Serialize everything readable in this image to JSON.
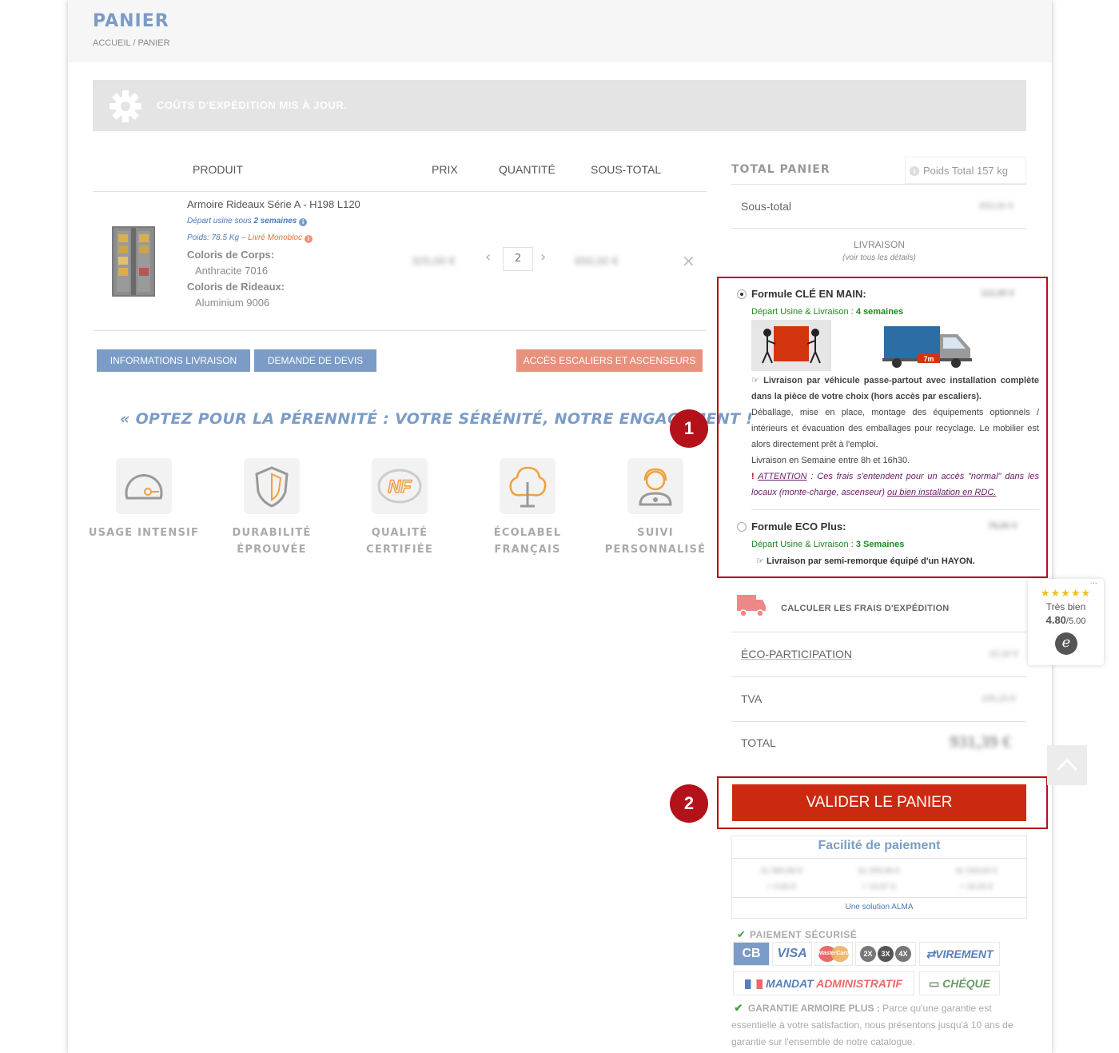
{
  "header": {
    "title": "PANIER",
    "breadcrumb": "ACCUEIL / PANIER"
  },
  "notice": {
    "text": "COÛTS D'EXPÉDITION MIS À JOUR.",
    "icon": "gear-icon"
  },
  "cart_table": {
    "columns": [
      "PRODUIT",
      "PRIX",
      "QUANTITÉ",
      "SOUS-TOTAL"
    ],
    "item": {
      "name": "Armoire Rideaux Série A - H198 L120",
      "departure_prefix": "Départ usine sous ",
      "departure_weeks": "2 semaines",
      "weight_line": "Poids: 78.5 Kg",
      "delivery_line": "Livré Monobloc",
      "attr1_label": "Coloris de Corps:",
      "attr1_value": "Anthracite 7016",
      "attr2_label": "Coloris de Rideaux:",
      "attr2_value": "Aluminium 9006",
      "price": "325,00 €",
      "quantity": "2",
      "subtotal": "650,00 €"
    }
  },
  "buttons": {
    "delivery_info": "INFORMATIONS LIVRAISON",
    "quote_request": "DEMANDE DE DEVIS",
    "stairs_access": "ACCÈS ESCALIERS ET ASCENSEURS"
  },
  "slogan": "« OPTEZ POUR LA PÉRENNITÉ : VOTRE SÉRÉNITÉ, NOTRE ENGAGEMENT !",
  "annotations": {
    "one": "1",
    "two": "2"
  },
  "features": [
    {
      "line1": "USAGE INTENSIF",
      "line2": "",
      "icon": "gauge-icon"
    },
    {
      "line1": "DURABILITÉ",
      "line2": "ÉPROUVÉE",
      "icon": "shield-icon"
    },
    {
      "line1": "QUALITÉ",
      "line2": "CERTIFIÉE",
      "icon": "nf-icon"
    },
    {
      "line1": "ÉCOLABEL",
      "line2": "FRANÇAIS",
      "icon": "tree-icon"
    },
    {
      "line1": "SUIVI",
      "line2": "PERSONNALISÉ",
      "icon": "support-icon"
    }
  ],
  "totals": {
    "title": "TOTAL PANIER",
    "weight": "Poids Total 157 kg",
    "subtotal_label": "Sous-total",
    "subtotal_value": "650,00 €",
    "shipping_label": "LIVRAISON",
    "shipping_sub": "(voir tous les détails)",
    "eco_label": "ÉCO-PARTICIPATION",
    "eco_value": "10,16 €",
    "tva_label": "TVA",
    "tva_value": "155,23 €",
    "total_label": "TOTAL",
    "total_value": "931,39 €"
  },
  "shipping_options": {
    "option1": {
      "title": "Formule CLÉ EN MAIN:",
      "price": "112,00 €",
      "departure_prefix": "Départ Usine & Livraison : ",
      "departure_weeks": "4 semaines",
      "truck_length": "7m",
      "desc_bold": "Livraison par véhicule passe-partout avec installation complète dans la pièce de votre choix (hors accès par escaliers).",
      "desc_body": "Déballage, mise en place, montage des équipements optionnels / intérieurs et évacuation des emballages pour recyclage. Le mobilier est alors directement prêt à l'emploi.",
      "desc_hours": "Livraison en Semaine entre 8h et 16h30.",
      "warn_mark": "!",
      "warn_link": "ATTENTION",
      "warn_text": " : Ces frais s'entendent pour un accès \"normal\" dans les locaux (monte-charge, ascenseur) ",
      "warn_link2": "ou bien installation en RDC."
    },
    "option2": {
      "title": "Formule ECO Plus:",
      "price": "78,00 €",
      "departure_prefix": "Départ Usine & Livraison : ",
      "departure_weeks": "3 Semaines",
      "desc": "Livraison par semi-remorque équipé d'un HAYON."
    }
  },
  "calc_shipping": "CALCULER LES FRAIS D'EXPÉDITION",
  "validate": "VALIDER LE PANIER",
  "payment": {
    "title": "Facilité de paiement",
    "plans": [
      {
        "top": "2x 380,99 €",
        "bottom": "+ 0,00 €"
      },
      {
        "top": "3x 255,99 €",
        "bottom": "+ 13,97 €"
      },
      {
        "top": "4x 193,00 €",
        "bottom": "+ 15,00 €"
      }
    ],
    "alma": "Une solution ALMA",
    "secure_title": "PAIEMENT SÉCURISÉ",
    "logos": {
      "cb": "CB",
      "visa": "VISA",
      "mastercard": "MasterCard",
      "x2": "2X",
      "x3": "3X",
      "x4": "4X",
      "virement": "VIREMENT",
      "mandat1": "MANDAT",
      "mandat2": "ADMINISTRATIF",
      "cheque": "CHÉQUE"
    },
    "guarantee_title": "GARANTIE ARMOIRE PLUS :",
    "guarantee_text": " Parce qu'une garantie est essentielle à votre satisfaction, nous présentons jusqu'à 10 ans de garantie sur l'ensemble de notre catalogue."
  },
  "trust_widget": {
    "stars": "★★★★★",
    "label": "Très bien",
    "score": "4.80",
    "max": "/5.00",
    "logo": "e",
    "dots": "..."
  },
  "colors": {
    "accent_blue": "#7b9cc6",
    "salmon": "#e9917c",
    "cta_red": "#cc2a10",
    "annotation_red": "#b3121b",
    "green": "#1e8a1e"
  }
}
